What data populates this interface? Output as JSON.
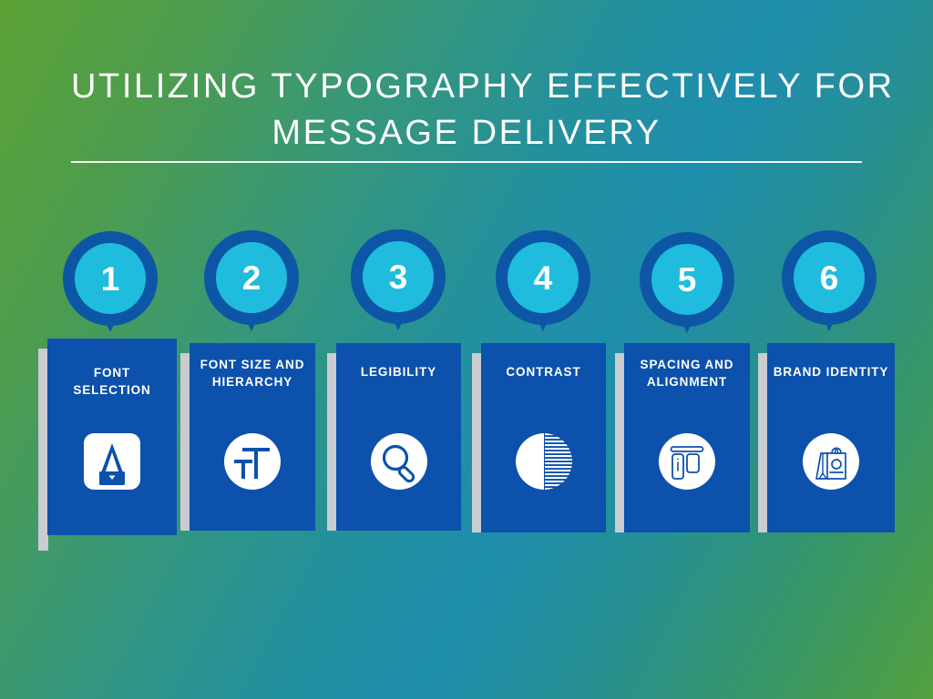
{
  "slide": {
    "title_lines": [
      "UTILIZING TYPOGRAPHY EFFECTIVELY FOR",
      "MESSAGE DELIVERY"
    ],
    "background_gradient": {
      "from": "#5ba235",
      "mid": "#1e8ead",
      "to": "#53a03e"
    },
    "colors": {
      "card_blue": "#0c51ab",
      "badge_ring": "#0d56a6",
      "badge_inner": "#1fbcdd",
      "shadow_bar": "#c9ccd1",
      "text_white": "#ffffff"
    }
  },
  "steps": [
    {
      "number": "1",
      "label": "FONT SELECTION",
      "icon": "letter-a-selection-icon"
    },
    {
      "number": "2",
      "label": "FONT SIZE AND HIERARCHY",
      "icon": "double-t-size-icon"
    },
    {
      "number": "3",
      "label": "LEGIBILITY",
      "icon": "magnifying-glass-icon"
    },
    {
      "number": "4",
      "label": "CONTRAST",
      "icon": "contrast-circle-icon"
    },
    {
      "number": "5",
      "label": "SPACING AND ALIGNMENT",
      "icon": "alignment-bars-icon"
    },
    {
      "number": "6",
      "label": "BRAND IDENTITY",
      "icon": "shopping-bag-icon"
    }
  ]
}
